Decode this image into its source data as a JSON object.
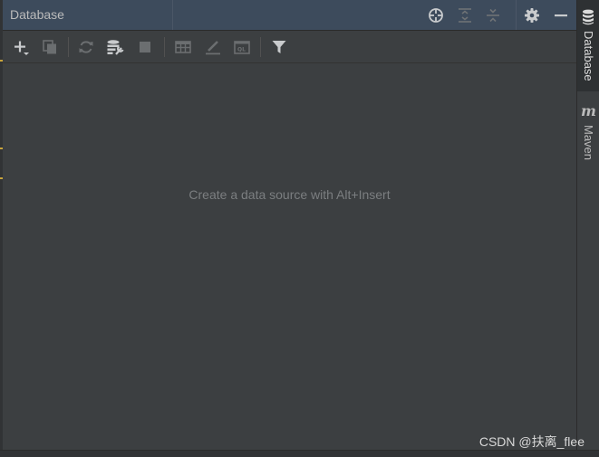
{
  "window": {
    "title": "Database"
  },
  "title_actions": {
    "locate_icon": "crosshair-icon",
    "expand_all_icon": "expand-all-icon",
    "collapse_all_icon": "collapse-all-icon",
    "settings_icon": "gear-icon",
    "hide_icon": "minimize-icon"
  },
  "toolbar": {
    "buttons": [
      "add-icon",
      "duplicate-icon",
      "refresh-icon",
      "properties-icon",
      "stop-icon",
      "table-icon",
      "edit-icon",
      "sql-console-icon",
      "filter-icon"
    ]
  },
  "content": {
    "empty_message": "Create a data source with Alt+Insert"
  },
  "right_strip": {
    "tabs": [
      {
        "label": "Database",
        "active": true
      },
      {
        "label": "Maven",
        "active": false
      }
    ],
    "maven_glyph": "m"
  },
  "watermark": "CSDN @扶离_flee",
  "colors": {
    "titlebar_bg": "#3d4b5c",
    "panel_bg": "#3c3f41",
    "text": "#bbbbbb",
    "muted_text": "#7b7e80",
    "disabled_icon": "#6e6e6e",
    "active_icon": "#afb1b3"
  }
}
